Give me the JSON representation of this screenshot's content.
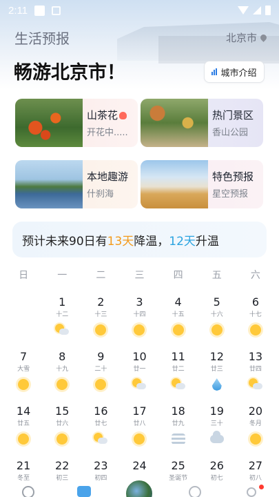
{
  "status_bar": {
    "time": "2:11"
  },
  "header": {
    "app_title": "生活预报",
    "city": "北京市",
    "headline": "畅游北京市！",
    "city_intro_label": "城市介绍"
  },
  "cards": [
    {
      "title": "山茶花",
      "subtitle": "开花中....."
    },
    {
      "title": "热门景区",
      "subtitle": "香山公园"
    },
    {
      "title": "本地趣游",
      "subtitle": "什刹海"
    },
    {
      "title": "特色预报",
      "subtitle": "星空预报"
    }
  ],
  "forecast": {
    "prefix": "预计未来90日有",
    "cool_days": "13天",
    "cool_label": "降温，",
    "warm_days": "12天",
    "warm_label": "升温",
    "cool_color": "#f39a1a",
    "warm_color": "#2aa3e0"
  },
  "weekdays": [
    "日",
    "一",
    "二",
    "三",
    "四",
    "五",
    "六"
  ],
  "calendar": [
    {
      "day": "",
      "lunar": "",
      "icon": ""
    },
    {
      "day": "1",
      "lunar": "十二",
      "icon": "partly-sunny-icon"
    },
    {
      "day": "2",
      "lunar": "十三",
      "icon": "sun-icon"
    },
    {
      "day": "3",
      "lunar": "十四",
      "icon": "sun-icon"
    },
    {
      "day": "4",
      "lunar": "十五",
      "icon": "sun-icon"
    },
    {
      "day": "5",
      "lunar": "十六",
      "icon": "sun-icon"
    },
    {
      "day": "6",
      "lunar": "十七",
      "icon": "sun-icon"
    },
    {
      "day": "7",
      "lunar": "大雪",
      "icon": "sun-icon"
    },
    {
      "day": "8",
      "lunar": "十九",
      "icon": "sun-icon"
    },
    {
      "day": "9",
      "lunar": "二十",
      "icon": "sun-icon"
    },
    {
      "day": "10",
      "lunar": "廿一",
      "icon": "partly-sunny-icon"
    },
    {
      "day": "11",
      "lunar": "廿二",
      "icon": "partly-sunny-icon"
    },
    {
      "day": "12",
      "lunar": "廿三",
      "icon": "rain-drop-icon"
    },
    {
      "day": "13",
      "lunar": "廿四",
      "icon": "partly-sunny-icon"
    },
    {
      "day": "14",
      "lunar": "廿五",
      "icon": "sun-icon"
    },
    {
      "day": "15",
      "lunar": "廿六",
      "icon": "sun-icon"
    },
    {
      "day": "16",
      "lunar": "廿七",
      "icon": "partly-sunny-icon"
    },
    {
      "day": "17",
      "lunar": "廿八",
      "icon": "sun-icon"
    },
    {
      "day": "18",
      "lunar": "廿九",
      "icon": "haze-icon"
    },
    {
      "day": "19",
      "lunar": "三十",
      "icon": "cloud-icon"
    },
    {
      "day": "20",
      "lunar": "冬月",
      "icon": "sun-icon"
    },
    {
      "day": "21",
      "lunar": "冬至",
      "icon": ""
    },
    {
      "day": "22",
      "lunar": "初三",
      "icon": ""
    },
    {
      "day": "23",
      "lunar": "初四",
      "icon": ""
    },
    {
      "day": "24",
      "lunar": "",
      "icon": ""
    },
    {
      "day": "25",
      "lunar": "圣诞节",
      "icon": ""
    },
    {
      "day": "26",
      "lunar": "初七",
      "icon": ""
    },
    {
      "day": "27",
      "lunar": "初八",
      "icon": ""
    }
  ],
  "bottom_nav": {
    "items": [
      "weather-icon",
      "calendar-icon",
      "life-center-icon",
      "moon-icon",
      "profile-icon"
    ],
    "notification_dot": true
  }
}
